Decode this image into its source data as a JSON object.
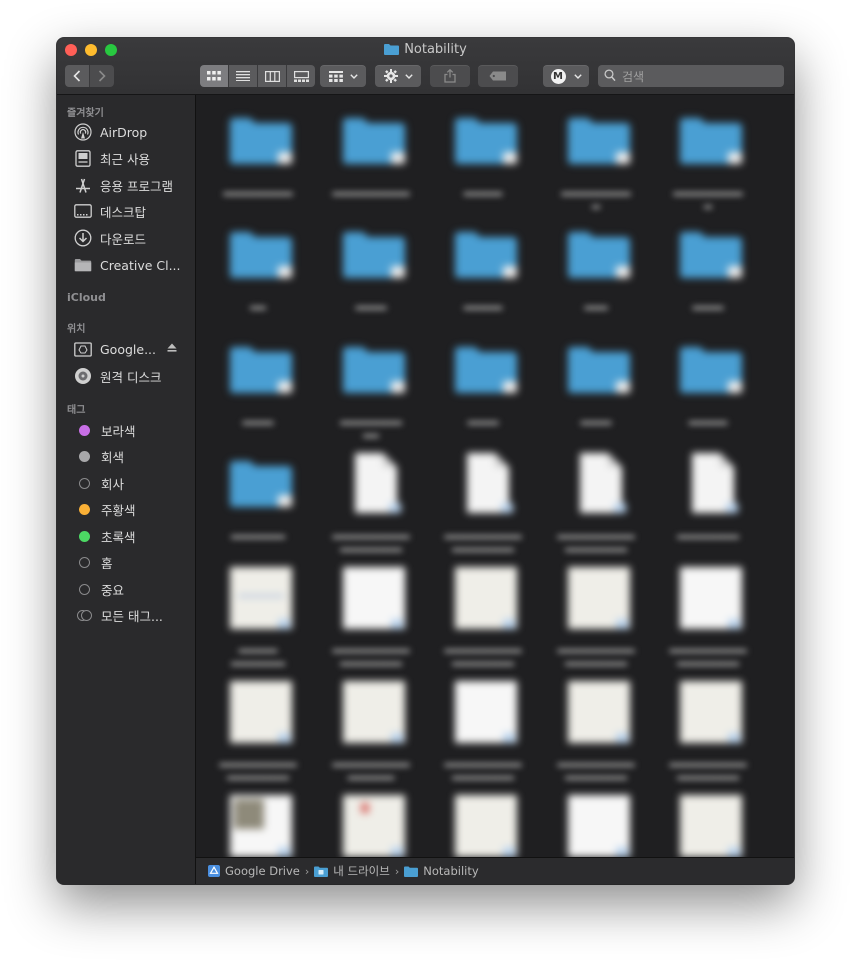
{
  "window": {
    "title": "Notability"
  },
  "toolbar": {
    "search_placeholder": "검색",
    "account_letter": "M"
  },
  "sidebar": {
    "favorites_header": "즐겨찾기",
    "favorites": [
      {
        "label": "AirDrop",
        "icon": "airdrop-icon"
      },
      {
        "label": "최근 사용",
        "icon": "recents-icon"
      },
      {
        "label": "응용 프로그램",
        "icon": "applications-icon"
      },
      {
        "label": "데스크탑",
        "icon": "desktop-icon"
      },
      {
        "label": "다운로드",
        "icon": "downloads-icon"
      },
      {
        "label": "Creative Cl...",
        "icon": "folder-icon"
      }
    ],
    "icloud_header": "iCloud",
    "locations_header": "위치",
    "locations": [
      {
        "label": "Google...",
        "icon": "google-drive-icon"
      },
      {
        "label": "원격 디스크",
        "icon": "remote-disc-icon"
      }
    ],
    "tags_header": "태그",
    "tags": [
      {
        "label": "보라색",
        "color": "#c86fe6"
      },
      {
        "label": "회색",
        "color": "#a8a8aa"
      },
      {
        "label": "회사",
        "color": ""
      },
      {
        "label": "주황색",
        "color": "#fab036"
      },
      {
        "label": "초록색",
        "color": "#4cd964"
      },
      {
        "label": "홈",
        "color": ""
      },
      {
        "label": "중요",
        "color": ""
      },
      {
        "label": "모든 태그...",
        "color": ""
      }
    ]
  },
  "pathbar": {
    "items": [
      "Google Drive",
      "내 드라이브",
      "Notability"
    ]
  },
  "colors": {
    "folder": "#4a9fd3",
    "window_bg": "#1f1f21",
    "sidebar_bg": "#2a2a2c"
  }
}
